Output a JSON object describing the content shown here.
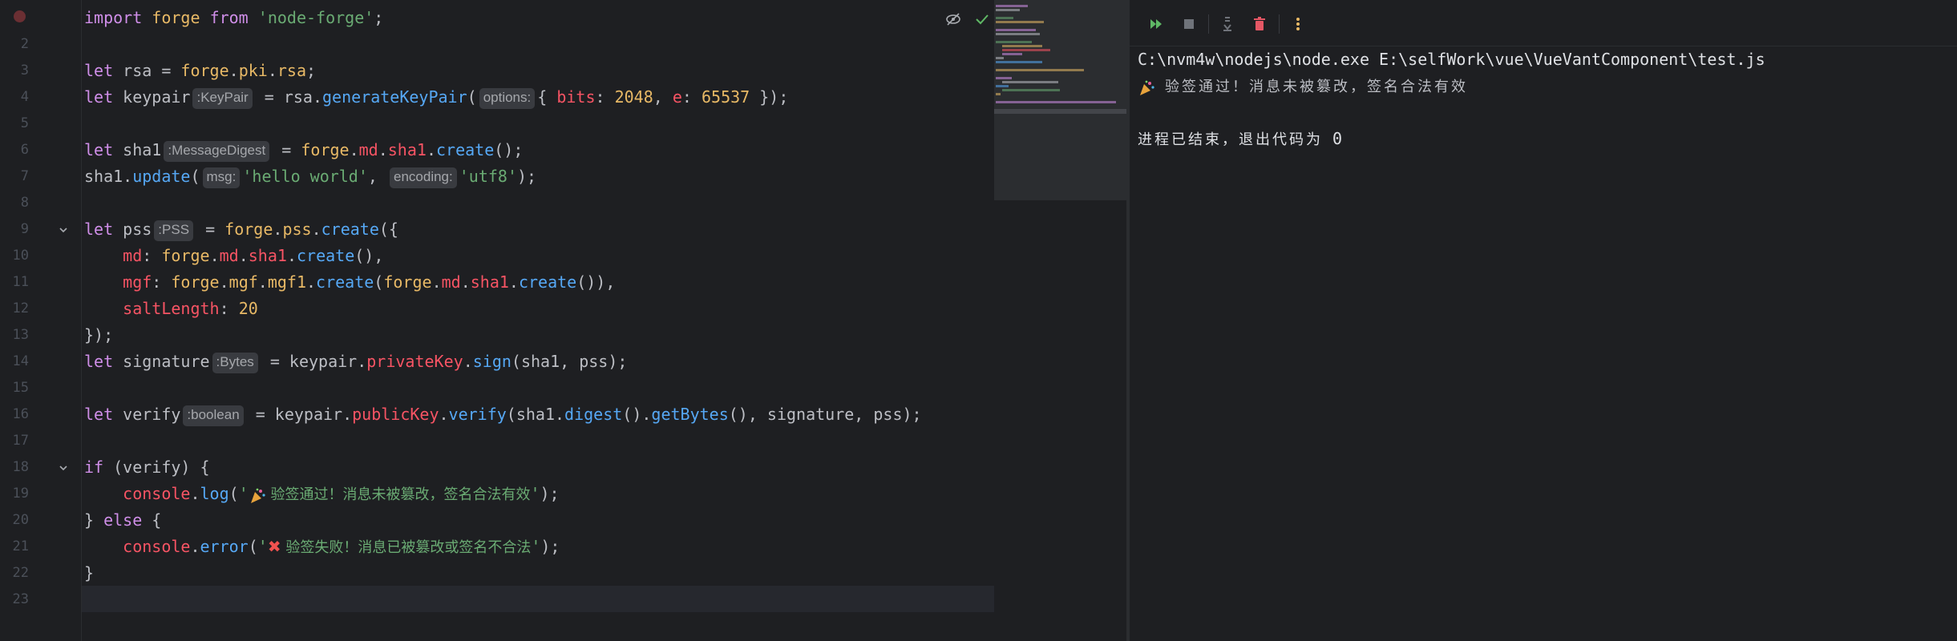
{
  "editor": {
    "line_numbers": [
      "2",
      "3",
      "4",
      "5",
      "6",
      "7",
      "8",
      "9",
      "10",
      "11",
      "12",
      "13",
      "14",
      "15",
      "16",
      "17",
      "18",
      "19",
      "20",
      "21",
      "22",
      "23"
    ],
    "lines": {
      "l1": {
        "kw_import": "import",
        "forge": "forge",
        "kw_from": "from",
        "str": "'node-forge'",
        "end": ";"
      },
      "l3": {
        "kw_let": "let",
        "var": "rsa",
        "eq": " = ",
        "forge": "forge",
        "dot1": ".",
        "pki": "pki",
        "dot2": ".",
        "rsa": "rsa",
        "end": ";"
      },
      "l4": {
        "kw_let": "let",
        "var": "keypair",
        "hint": ":KeyPair",
        "eq": " = ",
        "obj": "rsa",
        "dot": ".",
        "fn": "generateKeyPair",
        "open": "(",
        "hint_param": "options:",
        "brace": "{ ",
        "bits": "bits",
        "colon1": ": ",
        "bits_val": "2048",
        "comma": ", ",
        "e": "e",
        "colon2": ": ",
        "e_val": "65537",
        "close": " });"
      },
      "l6": {
        "kw_let": "let",
        "var": "sha1",
        "hint": ":MessageDigest",
        "eq": " = ",
        "forge": "forge",
        "dot1": ".",
        "md": "md",
        "dot2": ".",
        "sha1": "sha1",
        "dot3": ".",
        "fn": "create",
        "end": "();"
      },
      "l7": {
        "obj": "sha1",
        "dot": ".",
        "fn": "update",
        "open": "(",
        "hint_msg": "msg:",
        "str1": "'hello world'",
        "comma": ", ",
        "hint_enc": "encoding:",
        "str2": "'utf8'",
        "end": ");"
      },
      "l9": {
        "kw_let": "let",
        "var": "pss",
        "hint": ":PSS",
        "eq": " = ",
        "forge": "forge",
        "dot1": ".",
        "pss": "pss",
        "dot2": ".",
        "fn": "create",
        "end": "({"
      },
      "l10": {
        "prop": "md",
        "colon": ": ",
        "forge": "forge",
        "dot1": ".",
        "md": "md",
        "dot2": ".",
        "sha1": "sha1",
        "dot3": ".",
        "fn": "create",
        "end": "(),"
      },
      "l11": {
        "prop": "mgf",
        "colon": ": ",
        "forge": "forge",
        "dot1": ".",
        "mgf": "mgf",
        "dot2": ".",
        "mgf1": "mgf1",
        "dot3": ".",
        "fn": "create",
        "open": "(",
        "forge2": "forge",
        "dot4": ".",
        "md": "md",
        "dot5": ".",
        "sha1": "sha1",
        "dot6": ".",
        "fn2": "create",
        "end": "()),"
      },
      "l12": {
        "prop": "saltLength",
        "colon": ": ",
        "val": "20"
      },
      "l13": {
        "text": "});"
      },
      "l14": {
        "kw_let": "let",
        "var": "signature",
        "hint": ":Bytes",
        "eq": " = ",
        "obj": "keypair",
        "dot1": ".",
        "prop": "privateKey",
        "dot2": ".",
        "fn": "sign",
        "end": "(sha1, pss);"
      },
      "l16": {
        "kw_let": "let",
        "var": "verify",
        "hint": ":boolean",
        "eq": " = ",
        "obj": "keypair",
        "dot1": ".",
        "prop": "publicKey",
        "dot2": ".",
        "fn": "verify",
        "open": "(sha1.",
        "fn2": "digest",
        "mid": "().",
        "fn3": "getBytes",
        "end": "(), signature, pss);"
      },
      "l18": {
        "kw_if": "if",
        "rest": " (verify) {"
      },
      "l19": {
        "console": "console",
        "dot": ".",
        "fn": "log",
        "open": "(",
        "q1": "'",
        "msg": " 验签通过！消息未被篡改，签名合法有效",
        "q2": "'",
        "end": ");"
      },
      "l20": {
        "brace": "} ",
        "kw_else": "else",
        "rest": " {"
      },
      "l21": {
        "console": "console",
        "dot": ".",
        "fn": "error",
        "open": "(",
        "q1": "'",
        "x": "✖",
        "msg": " 验签失败！消息已被篡改或签名不合法",
        "q2": "'",
        "end": ");"
      },
      "l22": {
        "text": "}"
      }
    },
    "icons": {
      "eye": "eye-off-icon",
      "check": "check-icon"
    }
  },
  "run_panel": {
    "toolbar": [
      "rerun-icon",
      "stop-icon",
      "scroll-to-end-icon",
      "clear-icon",
      "more-icon"
    ],
    "console": {
      "command": "C:\\nvm4w\\nodejs\\node.exe E:\\selfWork\\vue\\VueVantComponent\\test.js",
      "output": "验签通过！消息未被篡改，签名合法有效",
      "exit_text": "进程已结束，退出代码为",
      "exit_code": "0"
    }
  },
  "colors": {
    "keyword": "#cf8ee8",
    "string": "#6aab73",
    "number": "#2aacb8",
    "function": "#56a8f5",
    "background": "#1e1f22"
  }
}
